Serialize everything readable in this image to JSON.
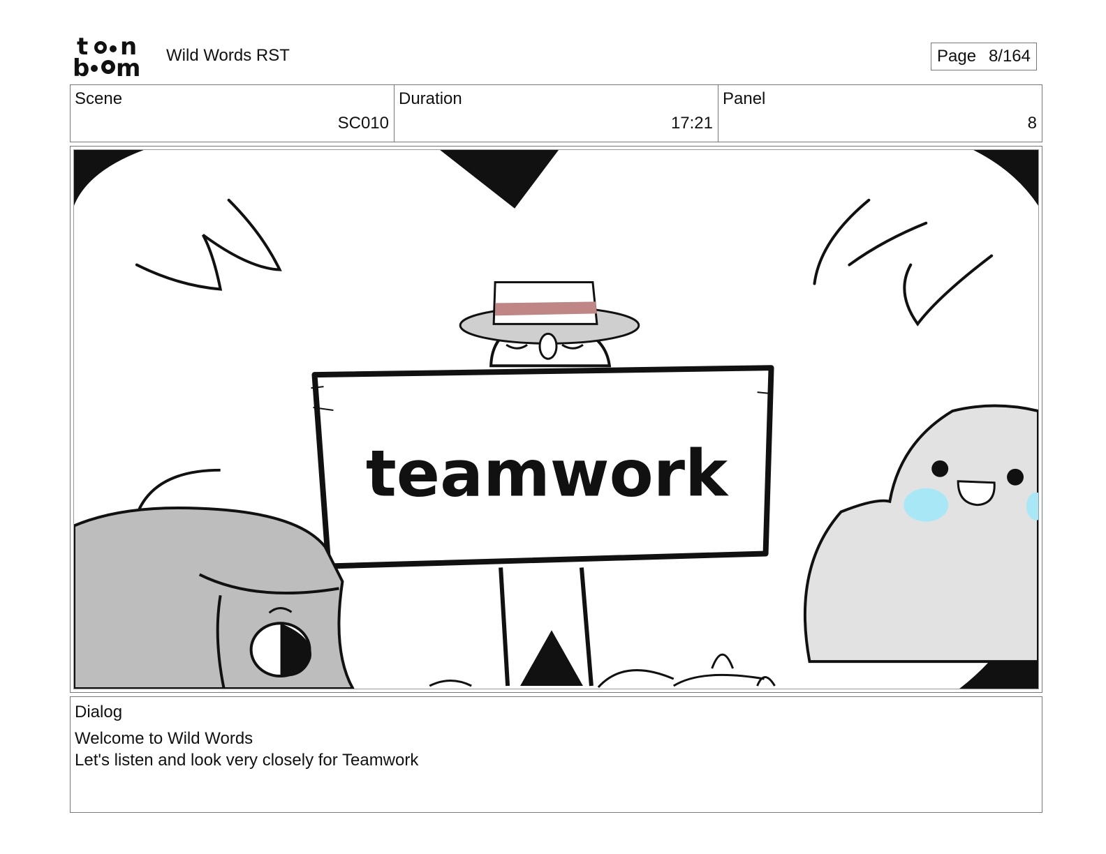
{
  "header": {
    "logo_text": "toonboom",
    "project_title": "Wild Words RST",
    "page_label": "Page",
    "page_value": "8/164"
  },
  "info": {
    "scene_label": "Scene",
    "scene_value": "SC010",
    "duration_label": "Duration",
    "duration_value": "17:21",
    "panel_label": "Panel",
    "panel_value": "8"
  },
  "panel_image": {
    "sign_text": "teamwork",
    "colors": {
      "ink": "#111111",
      "hat_band": "#c08585",
      "hat_brim": "#cfcfcf",
      "character_gray": "#bdbdbd",
      "blob_gray": "#e2e2e2",
      "blush": "#a8e8f6"
    }
  },
  "dialog": {
    "label": "Dialog",
    "lines": [
      "Welcome to Wild Words",
      "Let's listen and look very closely for Teamwork"
    ]
  }
}
